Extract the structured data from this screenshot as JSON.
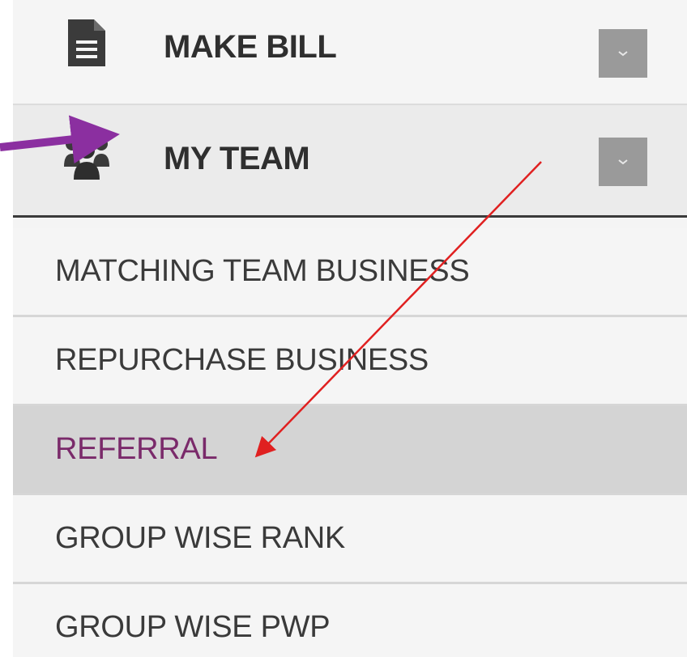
{
  "menu": {
    "headers": [
      {
        "label": "MAKE BILL",
        "icon": "document-icon"
      },
      {
        "label": "MY TEAM",
        "icon": "users-icon"
      }
    ],
    "submenu": [
      {
        "label": "MATCHING TEAM BUSINESS"
      },
      {
        "label": "REPURCHASE BUSINESS"
      },
      {
        "label": "REFERRAL",
        "active": true
      },
      {
        "label": "GROUP WISE RANK"
      },
      {
        "label": "GROUP WISE PWP"
      }
    ]
  },
  "colors": {
    "active_text": "#7a2a6a",
    "active_bg": "#d4d4d4",
    "purple_arrow": "#8b2fa0",
    "red_arrow": "#e02020",
    "chevron_bg": "#9a9a9a"
  },
  "annotations": [
    {
      "type": "arrow",
      "color": "purple",
      "points_to": "users-icon"
    },
    {
      "type": "arrow",
      "color": "red",
      "points_to": "REFERRAL"
    }
  ]
}
